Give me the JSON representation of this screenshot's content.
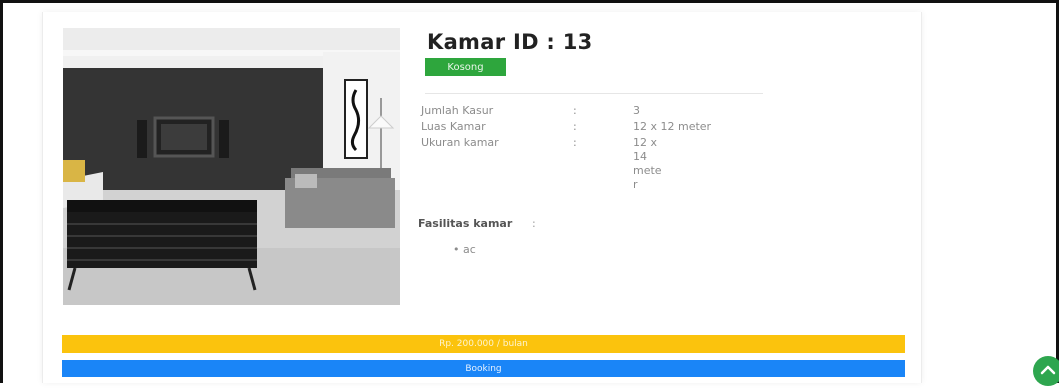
{
  "room": {
    "title": "Kamar ID : 13",
    "status": "Kosong",
    "details": [
      {
        "label": "Jumlah Kasur",
        "sep": ":",
        "value": "3"
      },
      {
        "label": "Luas Kamar",
        "sep": ":",
        "value": "12 x 12 meter"
      },
      {
        "label": "Ukuran kamar",
        "sep": ":",
        "value": "12 x 14 mete r"
      }
    ],
    "facilities_title": "Fasilitas kamar",
    "facilities_sep": ":",
    "facilities": [
      "ac"
    ]
  },
  "price_label": "Rp. 200.000 / bulan",
  "booking_label": "Booking",
  "icons": {
    "scroll_top": "chevron-up-icon"
  },
  "colors": {
    "status_green": "#2ea63d",
    "price_yellow": "#fbc30d",
    "booking_blue": "#1a85f7",
    "scroll_button_green": "#2ea64f"
  }
}
